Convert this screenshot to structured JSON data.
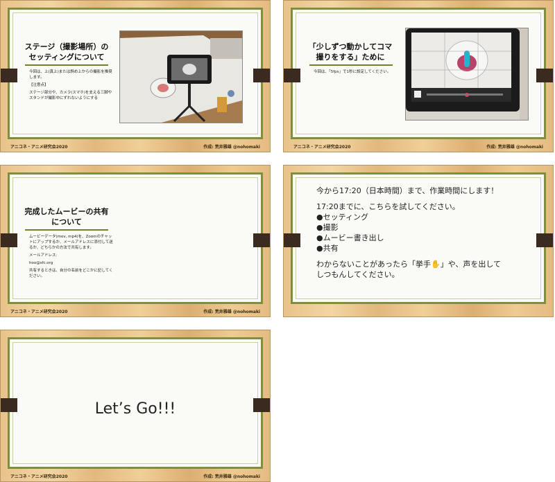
{
  "footer": {
    "left": "アニコネ・アニメ研究会2020",
    "right": "作成: 荒井雅雄 @nohomaki"
  },
  "slides": [
    {
      "title": "ステージ（撮影場所）の\nセッティングについて",
      "body": [
        "今回は、上(真上)または斜め上からの撮影を推奨します。",
        "【注意点】",
        "ステージ部分や、カメラ(スマホ)を支える三脚やスタンドが撮影中にずれないようにする"
      ]
    },
    {
      "title": "「少しずつ動かしてコマ\n撮りをする」ために",
      "body": [
        "今回は、「5fps」で1秒に設定してください。"
      ]
    },
    {
      "title": "完成したムービーの共有\nについて",
      "body": [
        "ムービーデータ(mov, mp4)を、Zoomのチャットにアップするか、メールアドレスに添付して送るか、どちらかの方法で共有します。",
        "メールアドレス:",
        "hoo@sfc.org",
        "共有するときは、自分の名前をどこかに記してください。"
      ]
    },
    {
      "lines": [
        "今から17:20（日本時間）まで、作業時間にします！",
        "",
        "17:20までに、こちらを試してください。",
        "●セッティング",
        "●撮影",
        "●ムービー書き出し",
        "●共有",
        "",
        "わからないことがあったら「挙手✋」や、声を出して",
        "しつもんしてください。"
      ]
    },
    {
      "title": "Let’s Go!!!"
    }
  ],
  "colors": {
    "wood": "#e8c38c",
    "frame": "#7f8f40",
    "clip": "#3b2a1f",
    "slide_bg": "#fafaf6"
  }
}
